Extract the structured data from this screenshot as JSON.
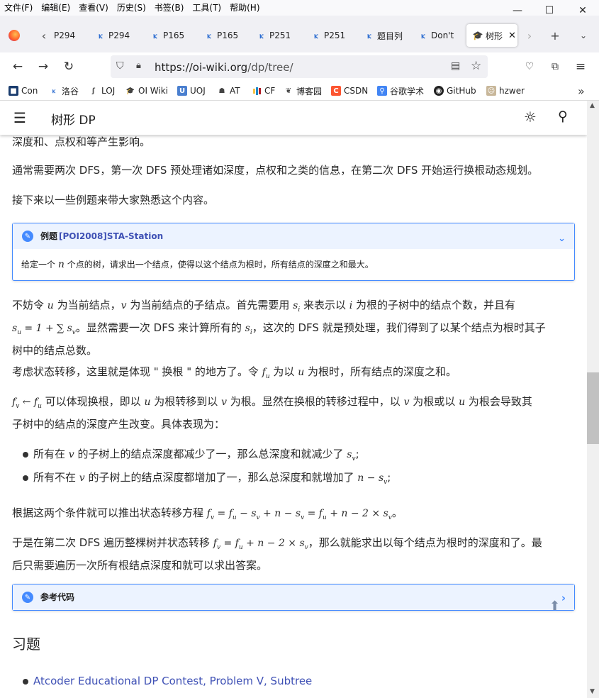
{
  "menubar": {
    "items": [
      "文件(F)",
      "编辑(E)",
      "查看(V)",
      "历史(S)",
      "书签(B)",
      "工具(T)",
      "帮助(H)"
    ]
  },
  "window_controls": {
    "minimize": "—",
    "maximize": "☐",
    "close": "✕"
  },
  "tabs": [
    {
      "label": "P294"
    },
    {
      "label": "P294"
    },
    {
      "label": "P165"
    },
    {
      "label": "P165"
    },
    {
      "label": "P251"
    },
    {
      "label": "P251"
    },
    {
      "label": "题目列"
    },
    {
      "label": "Don't"
    },
    {
      "label": "树形"
    }
  ],
  "nav": {
    "url_host": "https://oi-wiki.org",
    "url_path": "/dp/tree/"
  },
  "bookmarks": [
    {
      "label": "Con",
      "color": "#f0f0f0"
    },
    {
      "label": "洛谷",
      "color": "#2b6cd0"
    },
    {
      "label": "LOJ",
      "color": "#666666"
    },
    {
      "label": "OI Wiki",
      "color": "#222222"
    },
    {
      "label": "UOJ",
      "color": "#4a7fcf"
    },
    {
      "label": "AT",
      "color": "#444444"
    },
    {
      "label": "CF",
      "color": "#1f8acb"
    },
    {
      "label": "博客园",
      "color": "#444444"
    },
    {
      "label": "CSDN",
      "color": "#fc5531"
    },
    {
      "label": "谷歌学术",
      "color": "#4285f4"
    },
    {
      "label": "GitHub",
      "color": "#222222"
    },
    {
      "label": "hzwer",
      "color": "#888888"
    }
  ],
  "site": {
    "title": "树形 DP"
  },
  "content": {
    "p0": "深度和、点权和等产生影响。",
    "p1": "通常需要两次 DFS，第一次 DFS 预处理诸如深度，点权和之类的信息，在第二次 DFS 开始运行换根动态规划。",
    "p2": "接下来以一些例题来带大家熟悉这个内容。",
    "example_prefix": "例题",
    "example_title": "[POI2008]STA-Station",
    "example_body_1": "给定一个",
    "example_body_n": "n",
    "example_body_2": "个点的树，请求出一个结点，使得以这个结点为根时，所有结点的深度之和最大。",
    "p3_line1_a": "不妨令",
    "p3_u": "u",
    "p3_line1_b": "为当前结点，",
    "p3_v": "v",
    "p3_line1_c": "为当前结点的子结点。首先需要用",
    "p3_si": "s",
    "p3_line1_d": "来表示以",
    "p3_i": "i",
    "p3_line1_e": "为根的子树中的结点个数，并且有",
    "p3_formula": "s",
    "p3_line2_a": "。显然需要一次 DFS 来计算所有的",
    "p3_line2_b": "，这次的 DFS 就是预处理，我们得到了以某个结点为根时其子",
    "p3_line3": "树中的结点总数。",
    "p4_a": "考虑状态转移，这里就是体现 \" 换根 \" 的地方了。令",
    "p4_b": "为以",
    "p4_c": "为根时，所有结点的深度之和。",
    "p5_line1_a": "可以体现换根，即以",
    "p5_line1_b": "为根转移到以",
    "p5_line1_c": "为根。显然在换根的转移过程中，以",
    "p5_line1_d": "为根或以",
    "p5_line1_e": "为根会导致其",
    "p5_line2": "子树中的结点的深度产生改变。具体表现为：",
    "li1_a": "所有在",
    "li1_b": "的子树上的结点深度都减少了一，那么总深度和就减少了",
    "li2_a": "所有不在",
    "li2_b": "的子树上的结点深度都增加了一，那么总深度和就增加了",
    "p6_a": "根据这两个条件就可以推出状态转移方程",
    "p7_line1_a": "于是在第二次 DFS 遍历整棵树并状态转移",
    "p7_line1_b": "，那么就能求出以每个结点为根时的深度和了。最",
    "p7_line2": "后只需要遍历一次所有根结点深度和就可以求出答案。",
    "code_label": "参考代码",
    "exercises_heading": "习题",
    "exercise_1": "Atcoder Educational DP Contest, Problem V, Subtree"
  }
}
